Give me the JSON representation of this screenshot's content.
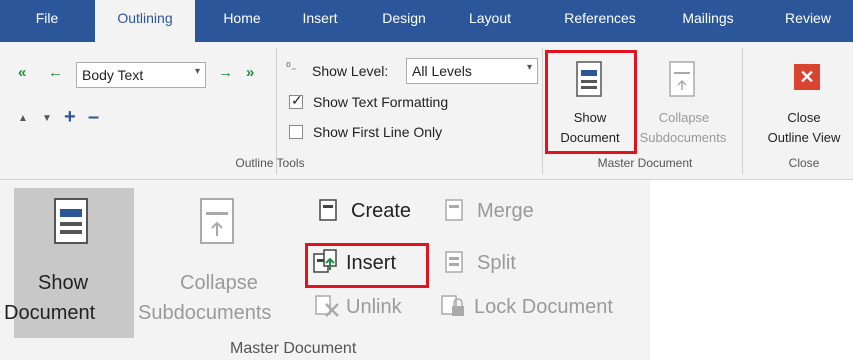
{
  "tabs": {
    "file": "File",
    "outlining": "Outlining",
    "home": "Home",
    "insert": "Insert",
    "design": "Design",
    "layout": "Layout",
    "references": "References",
    "mailings": "Mailings",
    "review": "Review"
  },
  "outline_tools": {
    "level_value": "Body Text",
    "show_level_label": "Show Level:",
    "show_level_value": "All Levels",
    "show_text_formatting": "Show Text Formatting",
    "show_text_formatting_checked": true,
    "show_first_line_only": "Show First Line Only",
    "show_first_line_only_checked": false,
    "group_label": "Outline Tools"
  },
  "master_document": {
    "show_line1": "Show",
    "show_line2": "Document",
    "collapse_line1": "Collapse",
    "collapse_line2": "Subdocuments",
    "group_label": "Master Document"
  },
  "close_group": {
    "close_line1": "Close",
    "close_line2": "Outline View",
    "group_label": "Close"
  },
  "zoom": {
    "show_line1": "Show",
    "show_line2": "Document",
    "collapse_line1": "Collapse",
    "collapse_line2": "Subdocuments",
    "create": "Create",
    "merge": "Merge",
    "insert": "Insert",
    "split": "Split",
    "unlink": "Unlink",
    "lock_document": "Lock Document",
    "group_label": "Master Document"
  },
  "colors": {
    "ribbon_blue": "#2b579a",
    "highlight_red": "#e0141e",
    "close_red": "#d9432f"
  }
}
